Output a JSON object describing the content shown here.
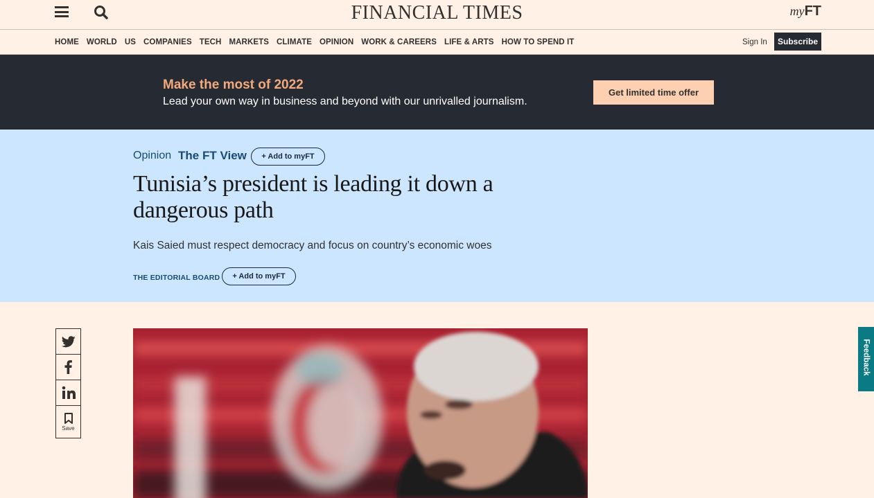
{
  "header": {
    "masthead": "FINANCIAL TIMES",
    "myft_my": "my",
    "myft_ft": "FT",
    "menu_icon": "hamburger-icon",
    "search_icon": "search-icon"
  },
  "nav": {
    "items": [
      "HOME",
      "WORLD",
      "US",
      "COMPANIES",
      "TECH",
      "MARKETS",
      "CLIMATE",
      "OPINION",
      "WORK & CAREERS",
      "LIFE & ARTS",
      "HOW TO SPEND IT"
    ],
    "sign_in": "Sign In",
    "subscribe": "Subscribe"
  },
  "promo": {
    "title": "Make the most of 2022",
    "subtitle": "Lead your own way in business and beyond with our unrivalled journalism.",
    "cta": "Get limited time offer"
  },
  "article": {
    "genre": "Opinion",
    "section": "The FT View",
    "add_myft": "Add to myFT",
    "headline": "Tunisia’s president is leading it down a dangerous path",
    "standfirst": "Kais Saied must respect democracy and focus on country’s economic woes",
    "byline": "THE EDITORIAL BOARD",
    "byline_add_myft": "Add to myFT"
  },
  "share": {
    "save_label": "Save",
    "icons": [
      "twitter-icon",
      "facebook-icon",
      "linkedin-icon",
      "bookmark-icon"
    ]
  },
  "feedback": {
    "label": "Feedback"
  },
  "colors": {
    "page_bg": "#fff1e5",
    "promo_bg": "#262a33",
    "promo_accent": "#f2a97e",
    "cta_bg": "#fcd0b1",
    "article_head_bg": "#cce6ff",
    "opinion_blue": "#1a4a75",
    "feedback_bg": "#0a7a85"
  }
}
